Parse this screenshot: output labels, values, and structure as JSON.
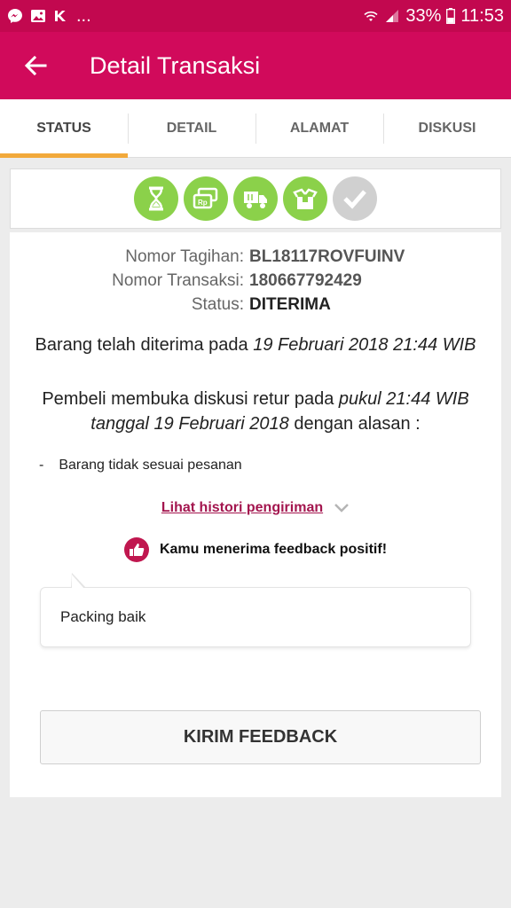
{
  "status_bar": {
    "battery": "33%",
    "time": "11:53",
    "notification_more": "..."
  },
  "app_bar": {
    "title": "Detail Transaksi",
    "back_icon": "arrow-left-icon"
  },
  "tabs": [
    {
      "label": "STATUS",
      "active": true
    },
    {
      "label": "DETAIL",
      "active": false
    },
    {
      "label": "ALAMAT",
      "active": false
    },
    {
      "label": "DISKUSI",
      "active": false
    }
  ],
  "progress_steps": [
    {
      "icon": "hourglass-icon",
      "state": "done"
    },
    {
      "icon": "payment-icon",
      "state": "done"
    },
    {
      "icon": "truck-icon",
      "state": "done"
    },
    {
      "icon": "package-received-icon",
      "state": "done"
    },
    {
      "icon": "check-icon",
      "state": "pending"
    }
  ],
  "colors": {
    "brand": "#d10a5b",
    "status_bar": "#c2084f",
    "tab_indicator": "#f2a93b",
    "step_done": "#8bd14a",
    "step_pending": "#d0d0d0",
    "link": "#a3154e"
  },
  "transaction": {
    "invoice_label": "Nomor Tagihan:",
    "invoice_value": "BL18117ROVFUINV",
    "trx_label": "Nomor Transaksi:",
    "trx_value": "180667792429",
    "status_label": "Status:",
    "status_value": "DITERIMA"
  },
  "received": {
    "prefix": "Barang telah diterima pada ",
    "date": "19 Februari 2018 21:44 WIB"
  },
  "retur": {
    "part1": "Pembeli membuka diskusi retur pada ",
    "time": "pukul 21:44 WIB",
    "part2": "tanggal 19 Februari 2018",
    "part3": " dengan alasan :"
  },
  "reasons": [
    {
      "bullet": "-",
      "text": "Barang tidak sesuai pesanan"
    }
  ],
  "history_link": "Lihat histori pengiriman",
  "feedback": {
    "message": "Kamu menerima feedback positif!",
    "comment": "Packing baik"
  },
  "send_feedback_button": "KIRIM FEEDBACK"
}
